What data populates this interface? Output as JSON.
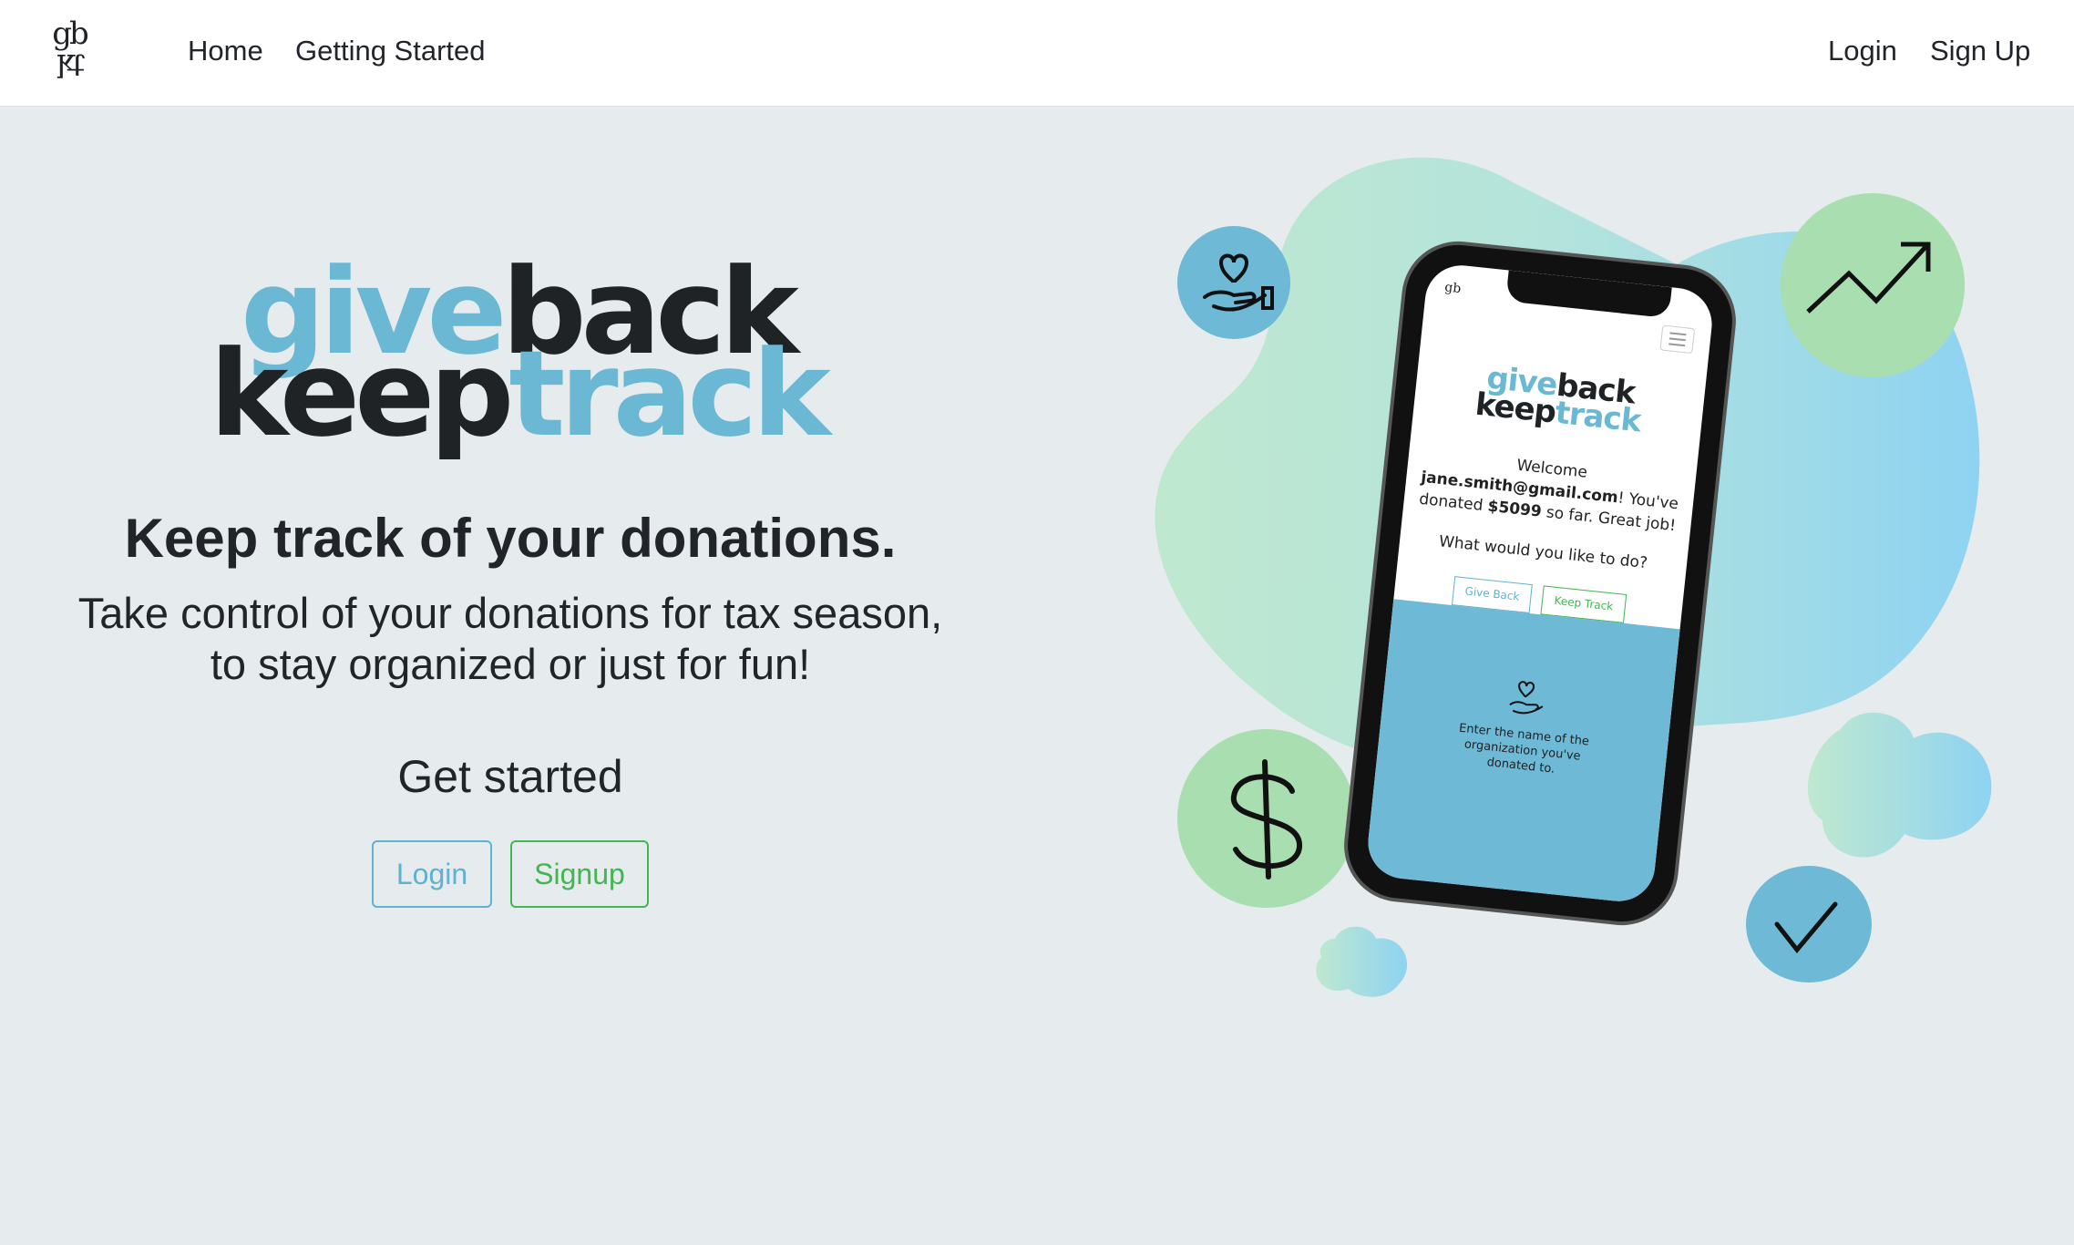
{
  "nav": {
    "logo_top": "gb",
    "logo_bottom": "kt",
    "links": [
      "Home",
      "Getting Started"
    ],
    "login": "Login",
    "signup": "Sign Up"
  },
  "brand": {
    "give": "give",
    "back": "back",
    "keep": "keep",
    "track": "track"
  },
  "hero": {
    "headline": "Keep track of your donations.",
    "subtitle_line1": "Take control of your donations for tax season,",
    "subtitle_line2": "to stay organized or just for fun!",
    "get_started": "Get started",
    "login_button": "Login",
    "signup_button": "Signup"
  },
  "phone": {
    "logo": "gb",
    "brand_give": "give",
    "brand_back": "back",
    "brand_keep": "keep",
    "brand_track": "track",
    "welcome": "Welcome",
    "email": "jane.smith@gmail.com",
    "youve": "! You've",
    "donated_pre": "donated ",
    "amount": "$5099",
    "donated_post": " so far. Great job!",
    "question": "What would you like to do?",
    "give_back_btn": "Give Back",
    "keep_track_btn": "Keep Track",
    "lower_text": "Enter the name of the organization you've donated to."
  },
  "colors": {
    "brand_blue": "#6bb8d4",
    "brand_dark": "#1f2326",
    "login_blue": "#5fb2d0",
    "signup_green": "#41b651",
    "page_bg": "#e6ebed"
  },
  "icons": [
    "heart-hand-icon",
    "trend-up-icon",
    "dollar-icon",
    "checkmark-icon"
  ]
}
